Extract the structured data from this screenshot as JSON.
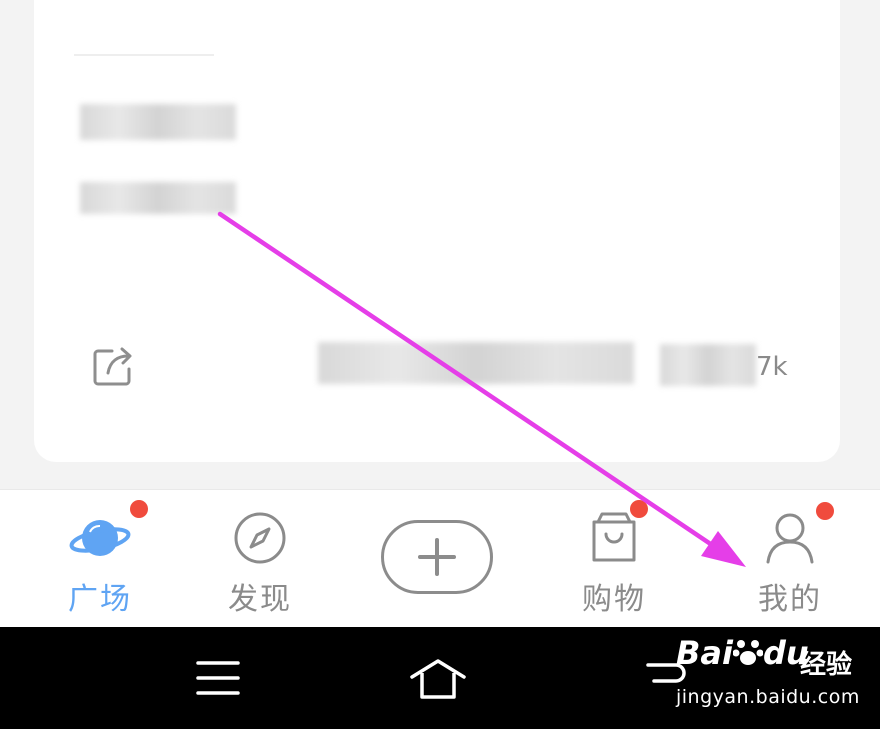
{
  "tab_bar": {
    "tabs": [
      {
        "label": "广场",
        "icon": "planet-icon",
        "active": true,
        "badge": true
      },
      {
        "label": "发现",
        "icon": "compass-icon",
        "active": false,
        "badge": false
      },
      {
        "label": "购物",
        "icon": "shopping-bag-icon",
        "active": false,
        "badge": true
      },
      {
        "label": "我的",
        "icon": "person-icon",
        "active": false,
        "badge": true
      }
    ],
    "post_button_icon": "plus-icon"
  },
  "feed_card": {
    "count_suffix": "7k",
    "share_icon": "share-icon"
  },
  "system_nav": {
    "items": [
      "menu-icon",
      "home-icon",
      "back-icon"
    ]
  },
  "watermark": {
    "logo": "Bai",
    "logo_tail": "du",
    "cn": "经验",
    "url": "jingyan.baidu.com"
  },
  "annotation": {
    "arrow_color": "#e53ee8"
  },
  "colors": {
    "active_tab": "#5fa4f3",
    "inactive_tab": "#8b8b8b",
    "badge": "#f04b3d",
    "nav_bar": "#000000"
  }
}
